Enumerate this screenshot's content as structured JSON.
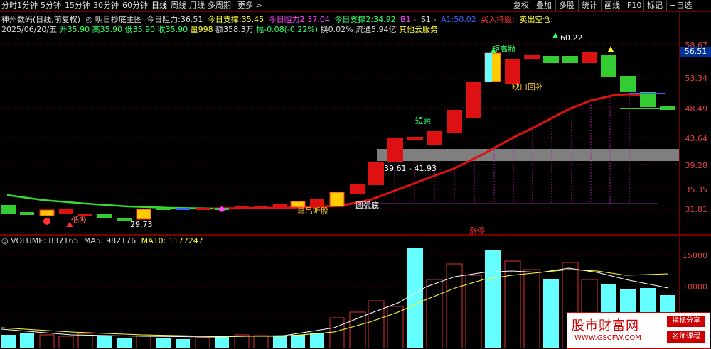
{
  "toolbar": {
    "periods": [
      "分时",
      "1分钟",
      "5分钟",
      "15分钟",
      "30分钟",
      "60分钟",
      "日线",
      "周线",
      "月线",
      "多周期",
      "更多 >"
    ],
    "active_period": "日线",
    "right_buttons": [
      "复权",
      "叠加",
      "多股",
      "统计",
      "画线",
      "F10",
      "标记",
      "+自选"
    ]
  },
  "info_line1": {
    "stock": "神州数码(日线,前复权)",
    "indicator": "明日抄底主图",
    "resist_today_label": "今日阻力:",
    "resist_today": "36.51",
    "support_today_label": "今日支撑:",
    "support_today": "35.45",
    "resist2_label": "今日阻力2:",
    "resist2": "37.04",
    "support2_label": "今日支撑2:",
    "support2": "34.92",
    "b1_label": "B1:",
    "b1": "-",
    "s1_label": "S1:",
    "s1": "-",
    "a1_label": "A1:",
    "a1": "50.02",
    "buy_hold": "买入持股:",
    "sell_empty": "卖出空仓:"
  },
  "info_line2": {
    "date": "2025/06/20/五",
    "open_label": "开",
    "open": "35.90",
    "high_label": "高",
    "high": "35.90",
    "low_label": "低",
    "low": "35.90",
    "close_label": "收",
    "close": "35.90",
    "vol_label": "量",
    "vol": "998",
    "amount_label": "额",
    "amount": "358.3万",
    "change_label": "幅",
    "change": "-0.08(-0.22%)",
    "turnover_label": "换",
    "turnover": "0.02%",
    "float_label": "流通",
    "float": "5.94亿",
    "other": "其他云服务"
  },
  "price_axis": [
    "58.67",
    "56.51",
    "53.34",
    "48.49",
    "43.64",
    "39.28",
    "35.35",
    "31.81"
  ],
  "current_price_tag": "56.51",
  "annotations": {
    "low_buy": "低吸",
    "low_price": "29.73",
    "buy_hold": "单吊听股",
    "arc_bottom": "圆弧底",
    "range": "39.61 - 41.93",
    "short_sell": "短卖",
    "short_throw": "短高抛",
    "gap_fill": "缺口回补",
    "high_price": "60.22",
    "limit_up": "涨停"
  },
  "volume": {
    "title": "VOLUME:",
    "value": "837165",
    "ma5_label": "MA5:",
    "ma5": "982176",
    "ma10_label": "MA10:",
    "ma10": "1177247",
    "axis": [
      "15000",
      "10000"
    ]
  },
  "watermark": {
    "title": "股市财富网",
    "url": "WWW.GSCFW.COM",
    "tag1": "指标分享",
    "tag2": "名师课程"
  }
}
